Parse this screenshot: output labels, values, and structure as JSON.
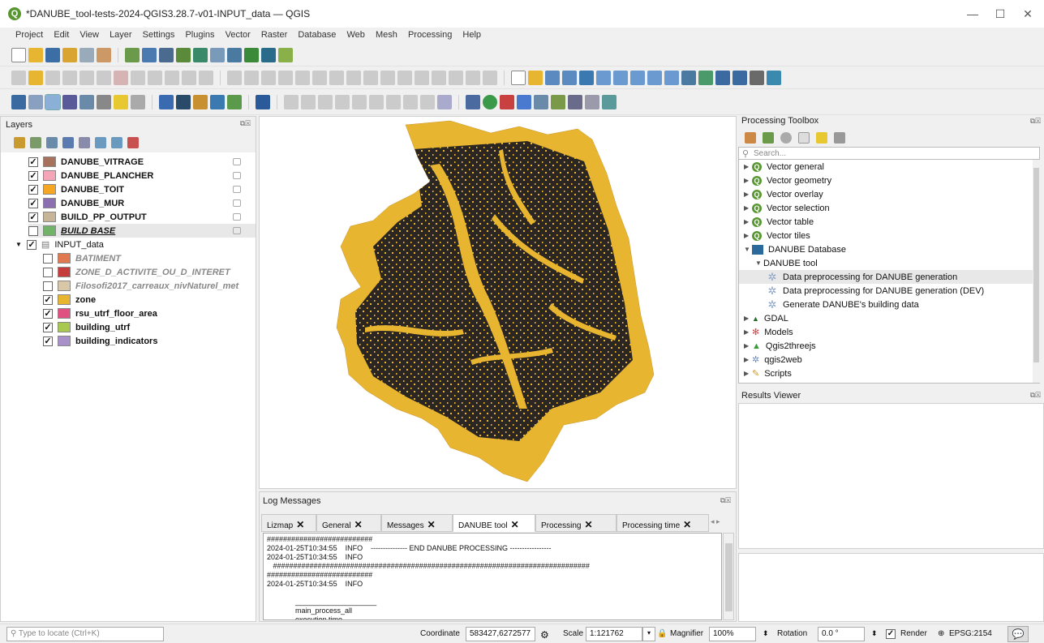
{
  "window": {
    "title": "*DANUBE_tool-tests-2024-QGIS3.28.7-v01-INPUT_data — QGIS",
    "minimize": "—",
    "maximize": "☐",
    "close": "✕"
  },
  "menu": [
    "Project",
    "Edit",
    "View",
    "Layer",
    "Settings",
    "Plugins",
    "Vector",
    "Raster",
    "Database",
    "Web",
    "Mesh",
    "Processing",
    "Help"
  ],
  "layers_panel": {
    "title": "Layers",
    "layers": [
      {
        "name": "DANUBE_VITRAGE",
        "checked": true,
        "color": "#a6725b"
      },
      {
        "name": "DANUBE_PLANCHER",
        "checked": true,
        "color": "#f4a5b8"
      },
      {
        "name": "DANUBE_TOIT",
        "checked": true,
        "color": "#f5a623"
      },
      {
        "name": "DANUBE_MUR",
        "checked": true,
        "color": "#8b6fb0"
      },
      {
        "name": "BUILD_PP_OUTPUT",
        "checked": true,
        "color": "#c7b59a"
      },
      {
        "name": "BUILD BASE",
        "checked": false,
        "color": "#72b36a"
      }
    ],
    "group": {
      "name": "INPUT_data",
      "checked": true
    },
    "group_layers": [
      {
        "name": "BATIMENT",
        "checked": false,
        "color": "#e07850"
      },
      {
        "name": "ZONE_D_ACTIVITE_OU_D_INTERET",
        "checked": false,
        "color": "#c43c3c"
      },
      {
        "name": "Filosofi2017_carreaux_nivNaturel_met",
        "checked": false,
        "color": "#d8c8a8"
      },
      {
        "name": "zone",
        "checked": true,
        "color": "#e8b530"
      },
      {
        "name": "rsu_utrf_floor_area",
        "checked": true,
        "color": "#e05080"
      },
      {
        "name": "building_utrf",
        "checked": true,
        "color": "#a8c850"
      },
      {
        "name": "building_indicators",
        "checked": true,
        "color": "#a890c8"
      }
    ]
  },
  "log_messages": {
    "title": "Log Messages",
    "tabs": [
      "Lizmap",
      "General",
      "Messages",
      "DANUBE tool",
      "Processing",
      "Processing time"
    ],
    "active_tab": "DANUBE tool",
    "lines": [
      "##########################",
      "2024-01-25T10:34:55    INFO    --------------- END DANUBE PROCESSING -----------------",
      "2024-01-25T10:34:55    INFO",
      "   ##############################################################################",
      "##########################",
      "2024-01-25T10:34:55    INFO",
      "",
      "              ____________________",
      "              main_process_all",
      "              execution time"
    ]
  },
  "toolbox": {
    "title": "Processing Toolbox",
    "search_placeholder": "Search...",
    "items": [
      {
        "label": "Vector general",
        "icon": "q",
        "indent": 0
      },
      {
        "label": "Vector geometry",
        "icon": "q",
        "indent": 0
      },
      {
        "label": "Vector overlay",
        "icon": "q",
        "indent": 0
      },
      {
        "label": "Vector selection",
        "icon": "q",
        "indent": 0
      },
      {
        "label": "Vector table",
        "icon": "q",
        "indent": 0
      },
      {
        "label": "Vector tiles",
        "icon": "q",
        "indent": 0
      },
      {
        "label": "DANUBE Database",
        "icon": "db",
        "indent": 0
      },
      {
        "label": "DANUBE tool",
        "icon": "none",
        "indent": 1
      },
      {
        "label": "Data preprocessing for DANUBE generation",
        "icon": "gear",
        "indent": 2
      },
      {
        "label": "Data preprocessing for DANUBE generation (DEV)",
        "icon": "gear",
        "indent": 2
      },
      {
        "label": "Generate DANUBE's building data",
        "icon": "gear",
        "indent": 2
      },
      {
        "label": "GDAL",
        "icon": "gdal",
        "indent": 0
      },
      {
        "label": "Models",
        "icon": "models",
        "indent": 0
      },
      {
        "label": "Qgis2threejs",
        "icon": "tri",
        "indent": 0
      },
      {
        "label": "qgis2web",
        "icon": "web",
        "indent": 0
      },
      {
        "label": "Scripts",
        "icon": "scripts",
        "indent": 0
      }
    ]
  },
  "results_viewer": {
    "title": "Results Viewer"
  },
  "statusbar": {
    "locate_placeholder": "Type to locate (Ctrl+K)",
    "coordinate_label": "Coordinate",
    "coordinate": "583427,6272577",
    "scale_label": "Scale",
    "scale": "1:121762",
    "magnifier_label": "Magnifier",
    "magnifier": "100%",
    "rotation_label": "Rotation",
    "rotation": "0.0 °",
    "render_label": "Render",
    "crs": "EPSG:2154"
  },
  "colors": {
    "zone": "#e8b530",
    "buildings": "#2b2622"
  }
}
